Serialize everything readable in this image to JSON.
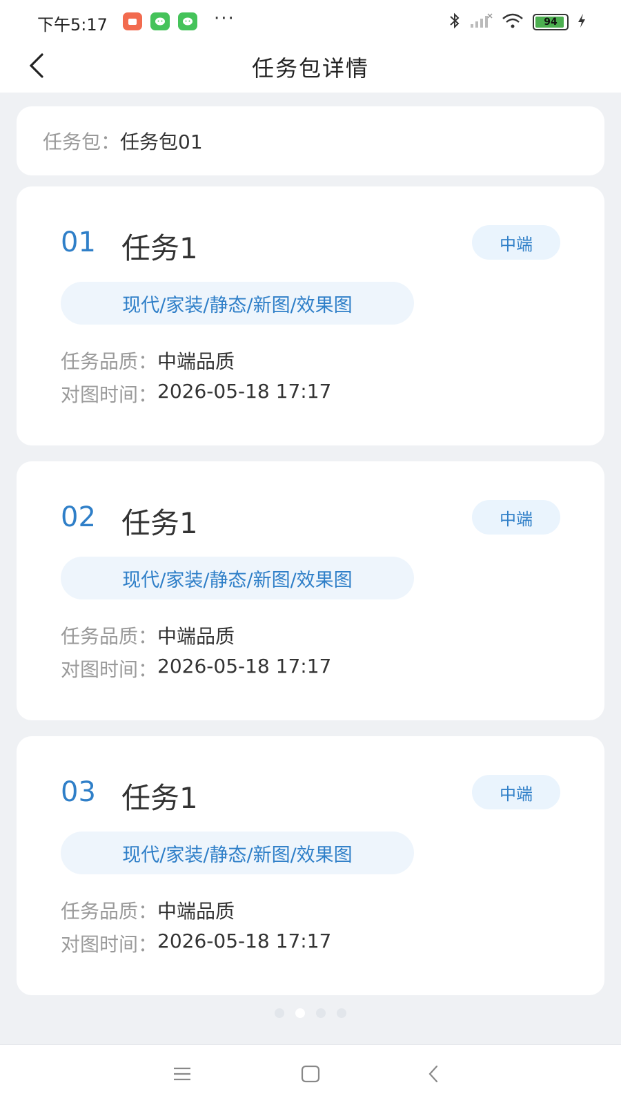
{
  "status_bar": {
    "time": "下午5:17",
    "app_icons": [
      {
        "name": "red-app-icon",
        "color": "#f26b4f"
      },
      {
        "name": "wechat-like-icon",
        "color": "#45c35a"
      },
      {
        "name": "wechat-like-icon-2",
        "color": "#45c35a"
      }
    ],
    "more": "···",
    "battery": "94",
    "battery_level": 0.94,
    "icons": [
      "bluetooth-icon",
      "signal-icon",
      "wifi-icon",
      "battery-icon",
      "charging-icon"
    ]
  },
  "nav": {
    "title": "任务包详情",
    "back_icon": "chevron-left-icon"
  },
  "package": {
    "label": "任务包：",
    "value": "任务包01"
  },
  "tasks": [
    {
      "num": "01",
      "name": "任务1",
      "level": "中端",
      "category": "现代/家装/静态/新图/效果图",
      "quality_label": "任务品质：",
      "quality": "中端品质",
      "time_label": "对图时间：",
      "time": "2026-05-18 17:17"
    },
    {
      "num": "02",
      "name": "任务1",
      "level": "中端",
      "category": "现代/家装/静态/新图/效果图",
      "quality_label": "任务品质：",
      "quality": "中端品质",
      "time_label": "对图时间：",
      "time": "2026-05-18 17:17"
    },
    {
      "num": "03",
      "name": "任务1",
      "level": "中端",
      "category": "现代/家装/静态/新图/效果图",
      "quality_label": "任务品质：",
      "quality": "中端品质",
      "time_label": "对图时间：",
      "time": "2026-05-18 17:17"
    }
  ],
  "pager": {
    "count": 4,
    "active": 1
  },
  "colors": {
    "accent": "#2f7fc8",
    "badge_bg": "#eaf4fd",
    "page_bg": "#eff1f4"
  },
  "bottom_nav": [
    "menu-icon",
    "home-square-icon",
    "back-chevron-icon"
  ]
}
